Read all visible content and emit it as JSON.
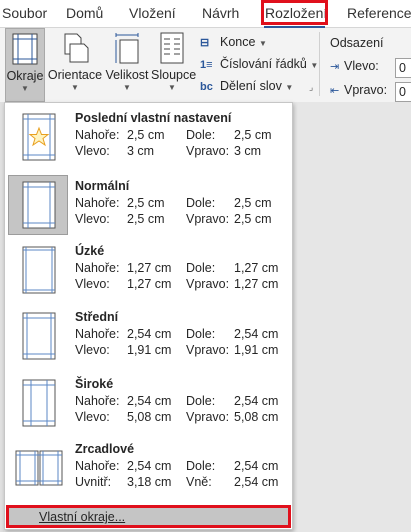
{
  "tabs": [
    {
      "label": "Soubor"
    },
    {
      "label": "Domů"
    },
    {
      "label": "Vložení"
    },
    {
      "label": "Návrh"
    },
    {
      "label": "Rozložení"
    },
    {
      "label": "Reference"
    }
  ],
  "active_tab": "Rozložení",
  "ribbon": {
    "okraje": "Okraje",
    "orientace": "Orientace",
    "velikost": "Velikost",
    "sloupce": "Sloupce",
    "konce": "Konce",
    "cislovani": "Číslování řádků",
    "deleni": "Dělení slov",
    "odsazeni_title": "Odsazení",
    "vlevo_label": "Vlevo:",
    "vlevo_value": "0",
    "vpravo_label": "Vpravo:",
    "vpravo_value": "0"
  },
  "margins_menu": {
    "options": [
      {
        "title": "Poslední vlastní nastavení",
        "nahore_label": "Nahoře:",
        "nahore": "2,5 cm",
        "dole_label": "Dole:",
        "dole": "2,5 cm",
        "vlevo_label": "Vlevo:",
        "vlevo": "3 cm",
        "vpravo_label": "Vpravo:",
        "vpravo": "3 cm",
        "icon": "page-star-icon"
      },
      {
        "title": "Normální",
        "nahore_label": "Nahoře:",
        "nahore": "2,5 cm",
        "dole_label": "Dole:",
        "dole": "2,5 cm",
        "vlevo_label": "Vlevo:",
        "vlevo": "2,5 cm",
        "vpravo_label": "Vpravo:",
        "vpravo": "2,5 cm",
        "icon": "page-normal-icon"
      },
      {
        "title": "Úzké",
        "nahore_label": "Nahoře:",
        "nahore": "1,27 cm",
        "dole_label": "Dole:",
        "dole": "1,27 cm",
        "vlevo_label": "Vlevo:",
        "vlevo": "1,27 cm",
        "vpravo_label": "Vpravo:",
        "vpravo": "1,27 cm",
        "icon": "page-narrow-icon"
      },
      {
        "title": "Střední",
        "nahore_label": "Nahoře:",
        "nahore": "2,54 cm",
        "dole_label": "Dole:",
        "dole": "2,54 cm",
        "vlevo_label": "Vlevo:",
        "vlevo": "1,91 cm",
        "vpravo_label": "Vpravo:",
        "vpravo": "1,91 cm",
        "icon": "page-moderate-icon"
      },
      {
        "title": "Široké",
        "nahore_label": "Nahoře:",
        "nahore": "2,54 cm",
        "dole_label": "Dole:",
        "dole": "2,54 cm",
        "vlevo_label": "Vlevo:",
        "vlevo": "5,08 cm",
        "vpravo_label": "Vpravo:",
        "vpravo": "5,08 cm",
        "icon": "page-wide-icon"
      },
      {
        "title": "Zrcadlové",
        "nahore_label": "Nahoře:",
        "nahore": "2,54 cm",
        "dole_label": "Dole:",
        "dole": "2,54 cm",
        "vlevo_label": "Uvnitř:",
        "vlevo": "3,18 cm",
        "vpravo_label": "Vně:",
        "vpravo": "2,54 cm",
        "icon": "page-mirrored-icon"
      }
    ],
    "selected": "Normální",
    "custom_label": "Vlastní okraje..."
  },
  "colors": {
    "accent": "#2b579a",
    "highlight": "#e0101c",
    "selected_bg": "#c5c5c5"
  }
}
